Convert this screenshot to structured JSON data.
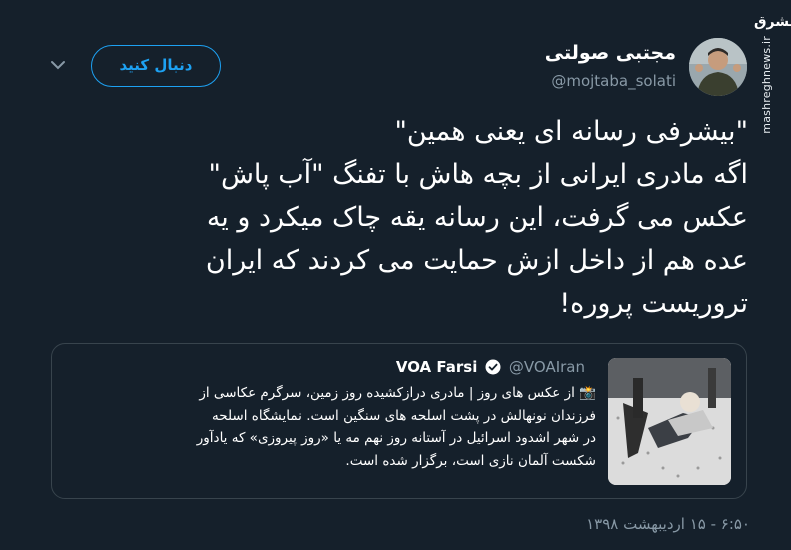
{
  "watermark": {
    "logo_text": "مشرق",
    "site": "mashreghnews.ir"
  },
  "author": {
    "name": "مجتبی صولتی",
    "handle": "@mojtaba_solati"
  },
  "follow_button_label": "دنبال کنید",
  "tweet": {
    "lines": [
      "\"بیشرفی رسانه ای یعنی همین\"",
      "اگه مادری ایرانی از بچه هاش با تفنگ \"آب پاش\"",
      "عکس می گرفت، این رسانه یقه چاک میکرد و یه",
      "عده هم از داخل ازش حمایت می کردند که ایران",
      "تروریست پروره!"
    ]
  },
  "quoted_tweet": {
    "name": "VOA Farsi",
    "handle": "@VOAIran",
    "lines": [
      "📸 از عکس های روز | مادری درازکشیده روز زمین، سرگرم عکاسی از",
      "فرزندان نونهالش در پشت اسلحه های سنگین است. نمایشگاه اسلحه",
      "در شهر اشدود اسرائیل در آستانه روز نهم مه یا «روز پیروزی» که یادآور",
      "شکست آلمان نازی است، برگزار شده است."
    ]
  },
  "timestamp": "۶:۵۰ - ۱۵ اردیبهشت ۱۳۹۸",
  "colors": {
    "background": "#15202b",
    "accent": "#1da1f2",
    "muted": "#8899a6",
    "border": "#38444d"
  }
}
